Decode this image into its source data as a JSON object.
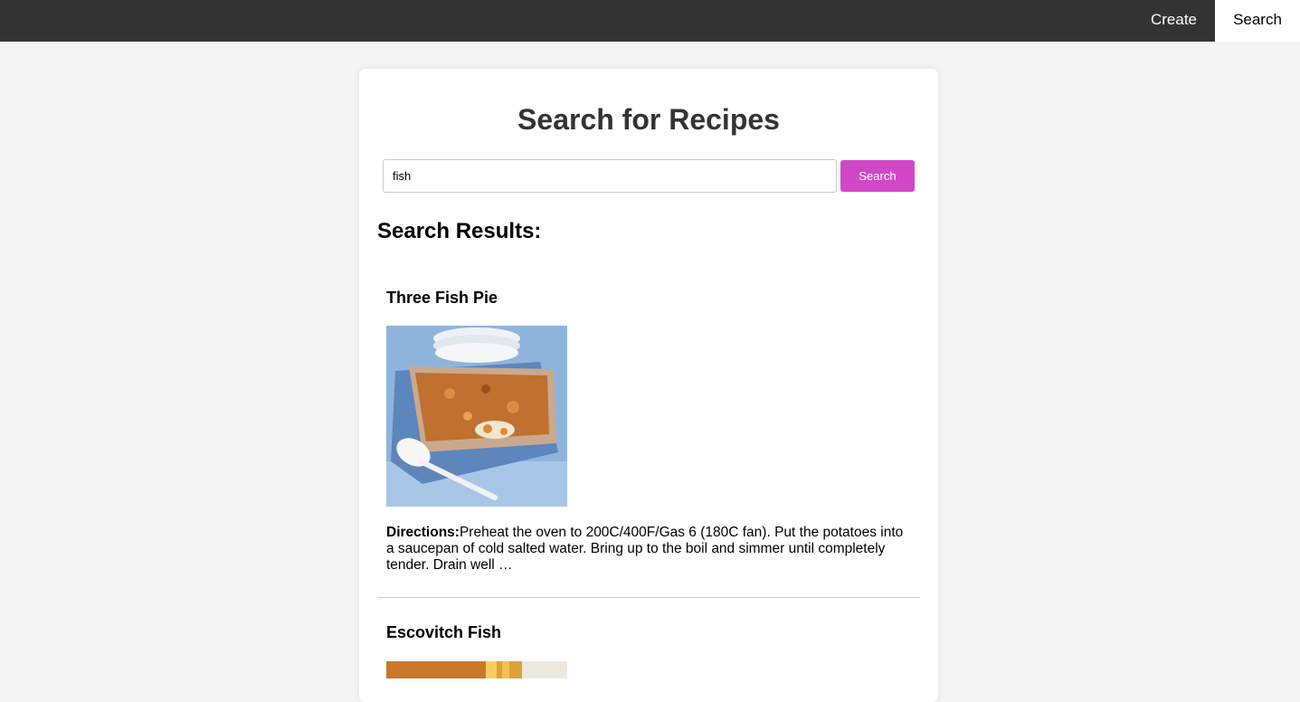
{
  "nav": {
    "create_label": "Create",
    "search_label": "Search"
  },
  "page": {
    "title": "Search for Recipes"
  },
  "search": {
    "value": "fish",
    "button_label": "Search"
  },
  "results": {
    "heading": "Search Results:",
    "items": [
      {
        "title": "Three Fish Pie",
        "image": "fish-pie-photo",
        "directions_label": "Directions:",
        "directions": "Preheat the oven to 200C/400F/Gas 6 (180C fan). Put the potatoes into a saucepan of cold salted water. Bring up to the boil and simmer until completely tender. Drain well …"
      },
      {
        "title": "Escovitch Fish",
        "image": "escovitch-fish-photo"
      }
    ]
  },
  "colors": {
    "navbar": "#333333",
    "accent": "#d147c8",
    "background": "#f4f4f4"
  }
}
